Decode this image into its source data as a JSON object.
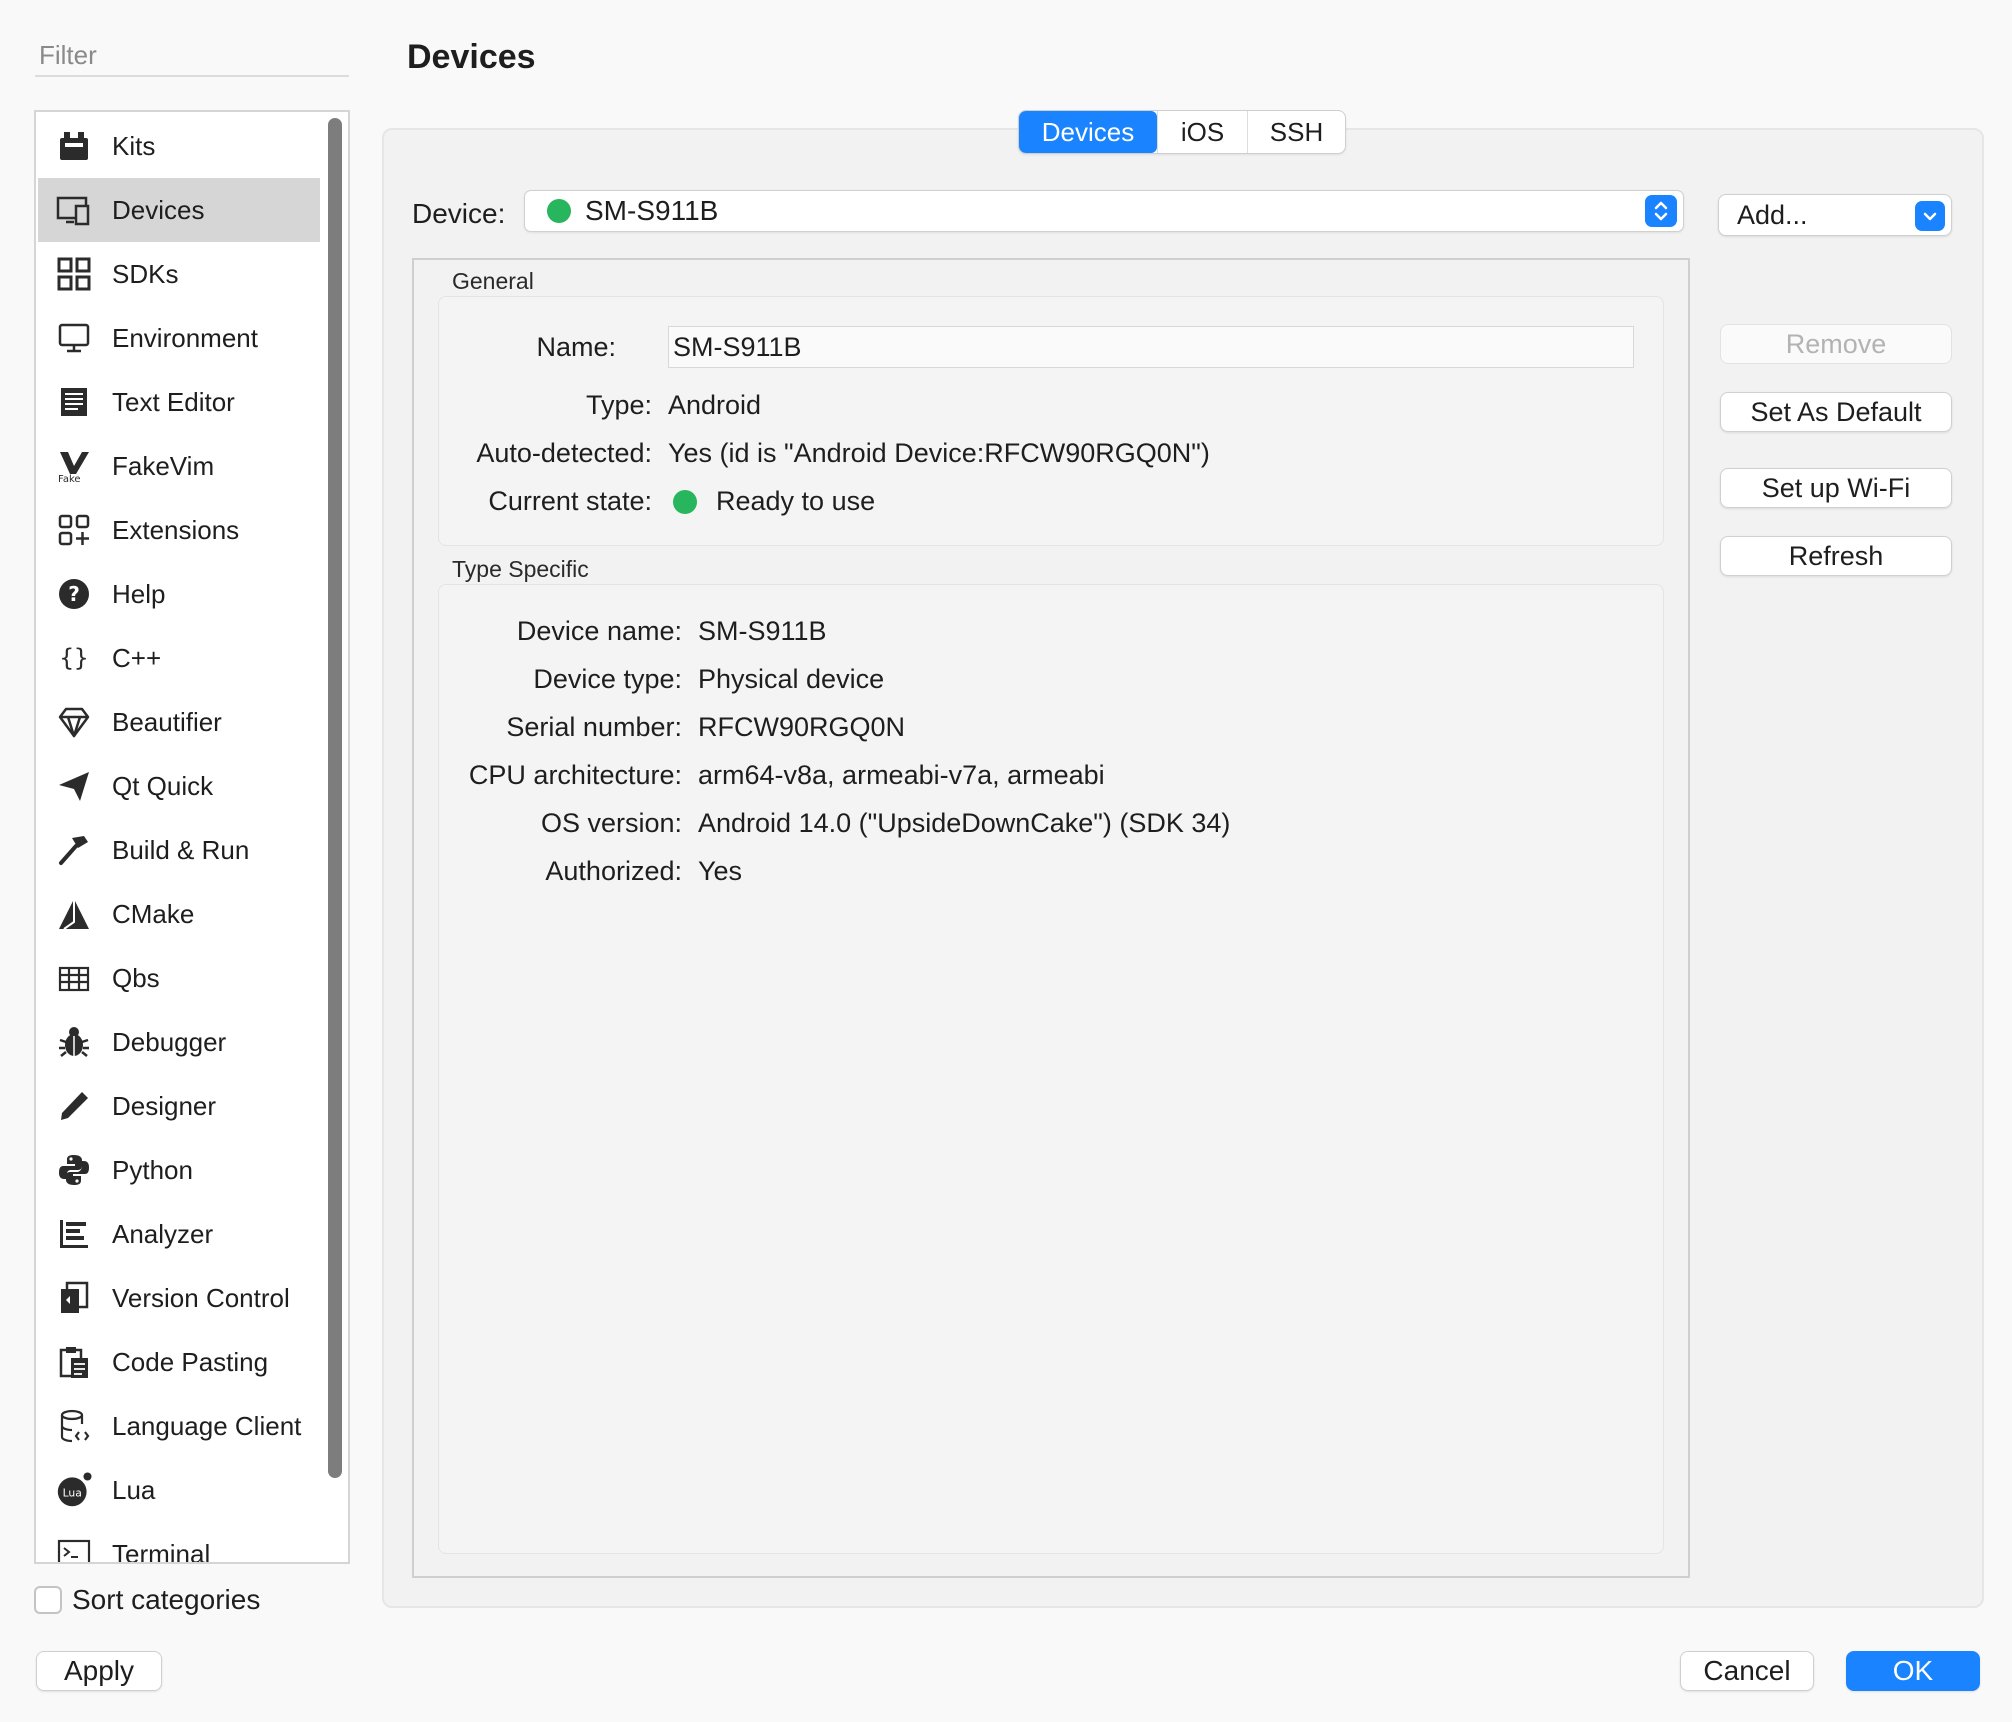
{
  "filter": {
    "placeholder": "Filter"
  },
  "sidebar": {
    "items": [
      {
        "label": "Kits",
        "icon": "kits-icon"
      },
      {
        "label": "Devices",
        "icon": "devices-icon",
        "selected": true
      },
      {
        "label": "SDKs",
        "icon": "sdks-icon"
      },
      {
        "label": "Environment",
        "icon": "environment-icon"
      },
      {
        "label": "Text Editor",
        "icon": "text-editor-icon"
      },
      {
        "label": "FakeVim",
        "icon": "fakevim-icon"
      },
      {
        "label": "Extensions",
        "icon": "extensions-icon"
      },
      {
        "label": "Help",
        "icon": "help-icon"
      },
      {
        "label": "C++",
        "icon": "cpp-icon"
      },
      {
        "label": "Beautifier",
        "icon": "beautifier-icon"
      },
      {
        "label": "Qt Quick",
        "icon": "qt-quick-icon"
      },
      {
        "label": "Build & Run",
        "icon": "build-run-icon"
      },
      {
        "label": "CMake",
        "icon": "cmake-icon"
      },
      {
        "label": "Qbs",
        "icon": "qbs-icon"
      },
      {
        "label": "Debugger",
        "icon": "debugger-icon"
      },
      {
        "label": "Designer",
        "icon": "designer-icon"
      },
      {
        "label": "Python",
        "icon": "python-icon"
      },
      {
        "label": "Analyzer",
        "icon": "analyzer-icon"
      },
      {
        "label": "Version Control",
        "icon": "version-control-icon"
      },
      {
        "label": "Code Pasting",
        "icon": "code-pasting-icon"
      },
      {
        "label": "Language Client",
        "icon": "language-client-icon"
      },
      {
        "label": "Lua",
        "icon": "lua-icon"
      },
      {
        "label": "Terminal",
        "icon": "terminal-icon"
      }
    ],
    "sort_label": "Sort categories"
  },
  "page": {
    "title": "Devices"
  },
  "tabs": [
    {
      "label": "Devices",
      "active": true
    },
    {
      "label": "iOS",
      "active": false
    },
    {
      "label": "SSH",
      "active": false
    }
  ],
  "device": {
    "label": "Device:",
    "selected": "SM-S911B",
    "status_color": "#27b55d"
  },
  "actions": {
    "add": "Add...",
    "remove": "Remove",
    "set_default": "Set As Default",
    "wifi": "Set up Wi-Fi",
    "refresh": "Refresh"
  },
  "general": {
    "title": "General",
    "name_label": "Name:",
    "name_value": "SM-S911B",
    "type_label": "Type:",
    "type_value": "Android",
    "auto_label": "Auto-detected:",
    "auto_value": "Yes (id is \"Android Device:RFCW90RGQ0N\")",
    "state_label": "Current state:",
    "state_value": "Ready to use"
  },
  "type_specific": {
    "title": "Type Specific",
    "rows": [
      {
        "label": "Device name:",
        "value": "SM-S911B"
      },
      {
        "label": "Device type:",
        "value": "Physical device"
      },
      {
        "label": "Serial number:",
        "value": "RFCW90RGQ0N"
      },
      {
        "label": "CPU architecture:",
        "value": "arm64-v8a, armeabi-v7a, armeabi"
      },
      {
        "label": "OS version:",
        "value": "Android 14.0 (\"UpsideDownCake\") (SDK 34)"
      },
      {
        "label": "Authorized:",
        "value": "Yes"
      }
    ]
  },
  "footer": {
    "apply": "Apply",
    "cancel": "Cancel",
    "ok": "OK"
  },
  "colors": {
    "accent": "#1a83ff",
    "selected_row": "#d6d6d6",
    "status_green": "#27b55d"
  }
}
